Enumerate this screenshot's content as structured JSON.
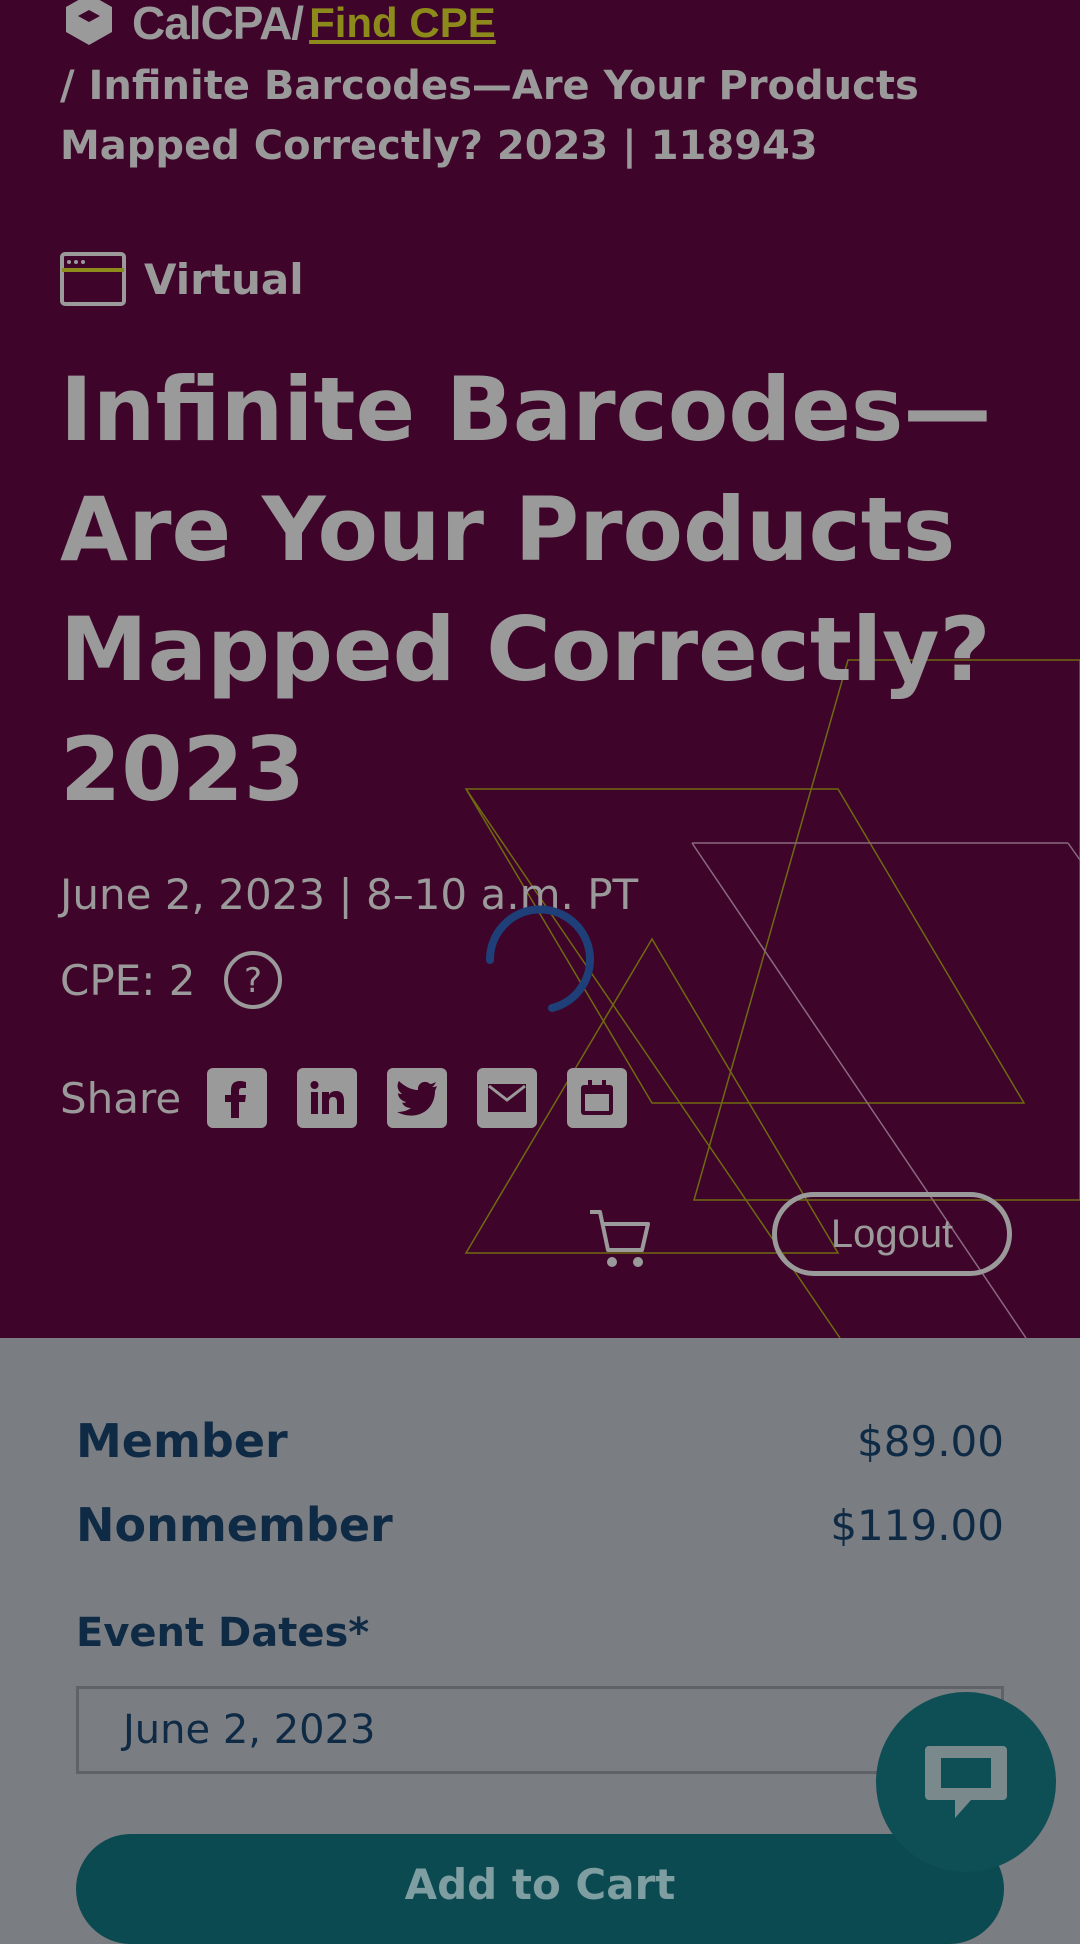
{
  "breadcrumb": {
    "brand": "CalCPA/",
    "find_cpe": "Find CPE",
    "current": "/ Infinite Barcodes—Are Your Products Mapped Correctly? 2023 | 118943"
  },
  "event": {
    "format_badge": "Virtual",
    "format_icon": "browser-window-icon",
    "title": "Infinite Barcodes—Are Your Products Mapped Correctly? 2023",
    "date_time": "June 2, 2023 | 8–10 a.m. PT",
    "cpe": "CPE: 2"
  },
  "share": {
    "label": "Share",
    "icons": [
      "facebook-icon",
      "linkedin-icon",
      "twitter-icon",
      "email-icon",
      "calendar-icon"
    ]
  },
  "header_actions": {
    "cart_icon": "cart-icon",
    "logout_label": "Logout"
  },
  "pricing": {
    "member_label": "Member",
    "member_price": "$89.00",
    "nonmember_label": "Nonmember",
    "nonmember_price": "$119.00"
  },
  "registration": {
    "event_dates_label": "Event Dates*",
    "selected_date": "June 2, 2023",
    "add_to_cart_label": "Add to Cart"
  },
  "colors": {
    "hero_bg": "#3f0429",
    "accent_olive": "#8c8a1a",
    "panel_bg": "#7a7d82",
    "navy_text": "#0f2a45",
    "teal_button": "#0a4a50",
    "spinner": "#1f3f78"
  }
}
